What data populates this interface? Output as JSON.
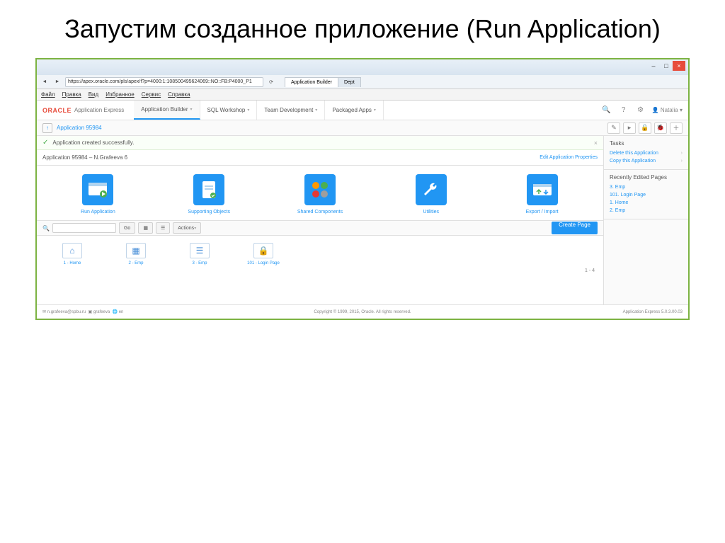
{
  "slide": {
    "title": "Запустим созданное приложение (Run Application)"
  },
  "browser": {
    "url": "https://apex.oracle.com/pls/apex/f?p=4000:1:108500495624069::NO::FB:P4000_P1",
    "tabs": [
      {
        "label": "Application Builder"
      },
      {
        "label": "Dept"
      }
    ],
    "menu": [
      "Файл",
      "Правка",
      "Вид",
      "Избранное",
      "Сервис",
      "Справка"
    ]
  },
  "header": {
    "logo_brand": "ORACLE",
    "product": "Application Express",
    "tabs": [
      {
        "label": "Application Builder",
        "active": true
      },
      {
        "label": "SQL Workshop",
        "active": false
      },
      {
        "label": "Team Development",
        "active": false
      },
      {
        "label": "Packaged Apps",
        "active": false
      }
    ],
    "user": "Natalia"
  },
  "breadcrumb": {
    "app": "Application 95984"
  },
  "success": {
    "msg": "Application created successfully."
  },
  "app_info": {
    "name": "Application 95984 – N.Grafeeva 6",
    "edit": "Edit Application Properties"
  },
  "tiles": [
    {
      "label": "Run Application",
      "icon": "run"
    },
    {
      "label": "Supporting Objects",
      "icon": "support"
    },
    {
      "label": "Shared Components",
      "icon": "shared"
    },
    {
      "label": "Utilities",
      "icon": "wrench"
    },
    {
      "label": "Export / Import",
      "icon": "export"
    }
  ],
  "toolbar": {
    "go": "Go",
    "actions": "Actions",
    "create": "Create Page"
  },
  "pages": [
    {
      "label": "1 - Home",
      "icon": "home"
    },
    {
      "label": "2 - Emp",
      "icon": "table"
    },
    {
      "label": "3 - Emp",
      "icon": "form"
    },
    {
      "label": "101 - Login Page",
      "icon": "lock"
    }
  ],
  "page_count": "1 - 4",
  "footer": {
    "left1": "n.grafeeva@spbu.ru",
    "left2": "grafeeva",
    "left3": "en",
    "mid": "Copyright © 1999, 2015, Oracle. All rights reserved.",
    "right": "Application Express 5.0.3.00.03"
  },
  "sidebar": {
    "tasks_title": "Tasks",
    "tasks": [
      "Delete this Application",
      "Copy this Application"
    ],
    "recent_title": "Recently Edited Pages",
    "recent": [
      "3. Emp",
      "101. Login Page",
      "1. Home",
      "2. Emp"
    ]
  }
}
